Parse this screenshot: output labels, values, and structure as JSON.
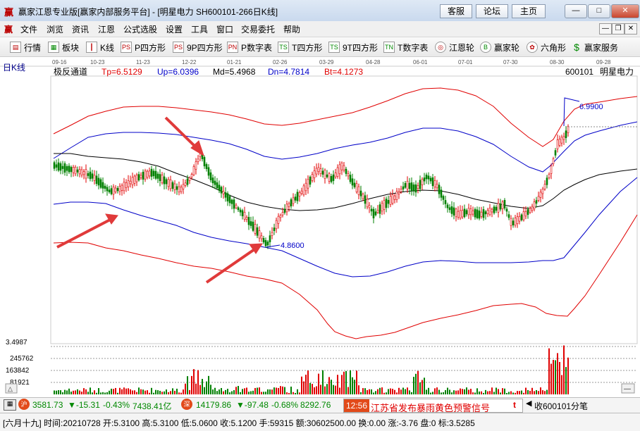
{
  "window": {
    "logo": "赢",
    "title": "赢家江恩专业版[赢家内部服务平台] - [明星电力  SH600101-266日K线]",
    "buttons": {
      "kefu": "客服",
      "luntan": "论坛",
      "zhuye": "主页"
    },
    "controls": {
      "minimize": "—",
      "maximize": "□",
      "close": "✕"
    }
  },
  "menu": {
    "logo": "赢",
    "items": [
      "文件",
      "浏览",
      "资讯",
      "江恩",
      "公式选股",
      "设置",
      "工具",
      "窗口",
      "交易委托",
      "帮助"
    ],
    "mdi": {
      "min": "—",
      "restore": "❐",
      "close": "✕"
    }
  },
  "toolbar": {
    "items": [
      {
        "icon": "▤",
        "label": "行情"
      },
      {
        "icon": "▦",
        "label": "板块"
      },
      {
        "icon": "┃",
        "label": "K线"
      },
      {
        "icon": "PS",
        "label": "P四方形"
      },
      {
        "icon": "PS",
        "label": "9P四方形"
      },
      {
        "icon": "PN",
        "label": "P数字表"
      },
      {
        "icon": "TS",
        "label": "T四方形"
      },
      {
        "icon": "TS",
        "label": "9T四方形"
      },
      {
        "icon": "TN",
        "label": "T数字表"
      },
      {
        "icon": "◎",
        "label": "江恩轮"
      },
      {
        "icon": "B",
        "label": "赢家轮"
      },
      {
        "icon": "✿",
        "label": "六角形"
      },
      {
        "icon": "$",
        "label": "赢家服务"
      }
    ]
  },
  "chart": {
    "period_label": "日K线",
    "dates": [
      "09-16",
      "10-23",
      "11-23",
      "12-22",
      "01-21",
      "02-26",
      "03-29",
      "04-28",
      "06-01",
      "07-01",
      "07-30",
      "08-30",
      "09-28"
    ],
    "indicator": {
      "name": "极反通道",
      "tp": "Tp=6.5129",
      "up": "Up=6.0396",
      "md": "Md=5.4968",
      "dn": "Dn=4.7814",
      "bt": "Bt=4.1273"
    },
    "stock_code": "600101",
    "stock_name": "明星电力",
    "high_label": "6.9900",
    "low_label": "4.8600",
    "volume_axis": [
      "3.4987",
      "245762",
      "163842",
      "81921"
    ],
    "colors": {
      "up": "#e00000",
      "down": "#008000",
      "mid": "#000000",
      "inner": "#0000c8",
      "outer": "#e00000"
    }
  },
  "status": {
    "sh_value": "3581.73",
    "sh_change": "▼-15.31",
    "sh_pct": "-0.43%",
    "sh_amount": "7438.41亿",
    "sz_value": "14179.86",
    "sz_change": "▼-97.48",
    "sz_pct": "-0.68%",
    "sz_amount": "8292.76",
    "news_time": "12:56",
    "news_text": "江苏省发布暴雨黄色预警信号",
    "news_tag": "t",
    "close_label": "收600101分笔"
  },
  "bottom": {
    "text": "[六月十九] 时间:20210728 开:5.3100 高:5.3100 低:5.0600 收:5.1200 手:59315 额:30602500.00 换:0.00 涨:-3.76 盘:0 标:3.5285"
  }
}
